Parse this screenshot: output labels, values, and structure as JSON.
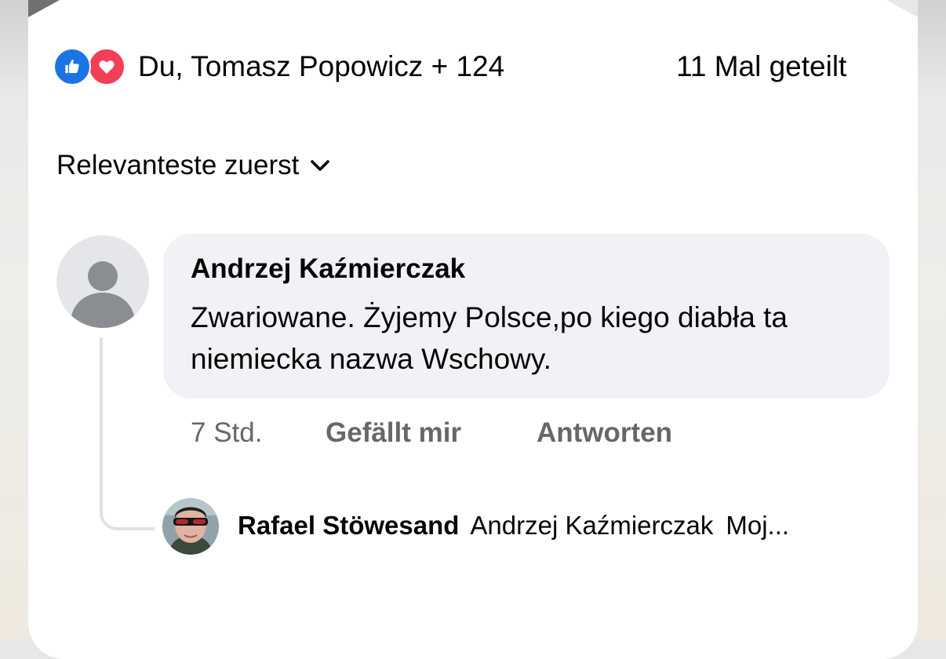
{
  "reactions": {
    "icons": [
      "like-icon",
      "love-icon"
    ],
    "summary": "Du, Tomasz Popowicz + 124",
    "shares": "11 Mal geteilt",
    "colors": {
      "like": "#1b74e4",
      "love": "#f33e58"
    }
  },
  "sort": {
    "label": "Relevanteste zuerst",
    "icon": "chevron-down-icon"
  },
  "comment": {
    "author": "Andrzej Kaźmierczak",
    "text": "Zwariowane. Żyjemy Polsce,po kiego diabła ta niemiecka nazwa Wschowy.",
    "time": "7 Std.",
    "like_label": "Gefällt mir",
    "reply_label": "Antworten",
    "avatar_icon": "default-avatar-icon"
  },
  "reply": {
    "author": "Rafael Stöwesand",
    "mention": "Andrzej Kaźmierczak",
    "snippet": "Moj..."
  }
}
